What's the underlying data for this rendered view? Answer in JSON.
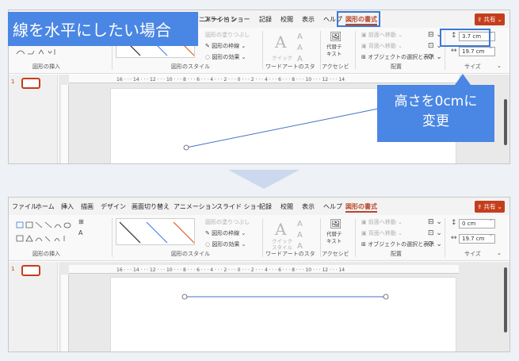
{
  "tabs": [
    "ファイル",
    "ホーム",
    "挿入",
    "描画",
    "デザイン",
    "画面切り替え",
    "アニメーション",
    "スライド ショー",
    "記録",
    "校閲",
    "表示",
    "ヘルプ",
    "図形の書式"
  ],
  "share_label": "共有",
  "ribbon": {
    "groups": [
      "図形の挿入",
      "図形のスタイル",
      "ワードアートのスタ",
      "アクセシビ",
      "配置",
      "サイズ"
    ],
    "fill_label": "図形の塗りつぶし",
    "outline_label": "図形の枠線",
    "effect_label": "図形の効果",
    "quick_style_label": "クイック\nスタイル",
    "alt_text_label": "代替テ\nキスト",
    "bring_forward": "前面へ移動",
    "send_backward": "背面へ移動",
    "selection_pane": "オブジェクトの選択と表示"
  },
  "before": {
    "height": "3.7 cm",
    "width": "19.7 cm"
  },
  "after": {
    "height": "0 cm",
    "width": "19.7 cm"
  },
  "callouts": {
    "title": "線を水平にしたい場合",
    "instruction": "高さを0cmに\n変更"
  },
  "ruler_numbers": [
    "16",
    "14",
    "12",
    "10",
    "8",
    "6",
    "4",
    "2",
    "0",
    "2",
    "4",
    "6",
    "8",
    "10",
    "12",
    "14",
    "16"
  ],
  "slide_number": "1",
  "colors": {
    "accent": "#b7472a",
    "callout": "#4a86e3",
    "line": "#4472c4"
  }
}
